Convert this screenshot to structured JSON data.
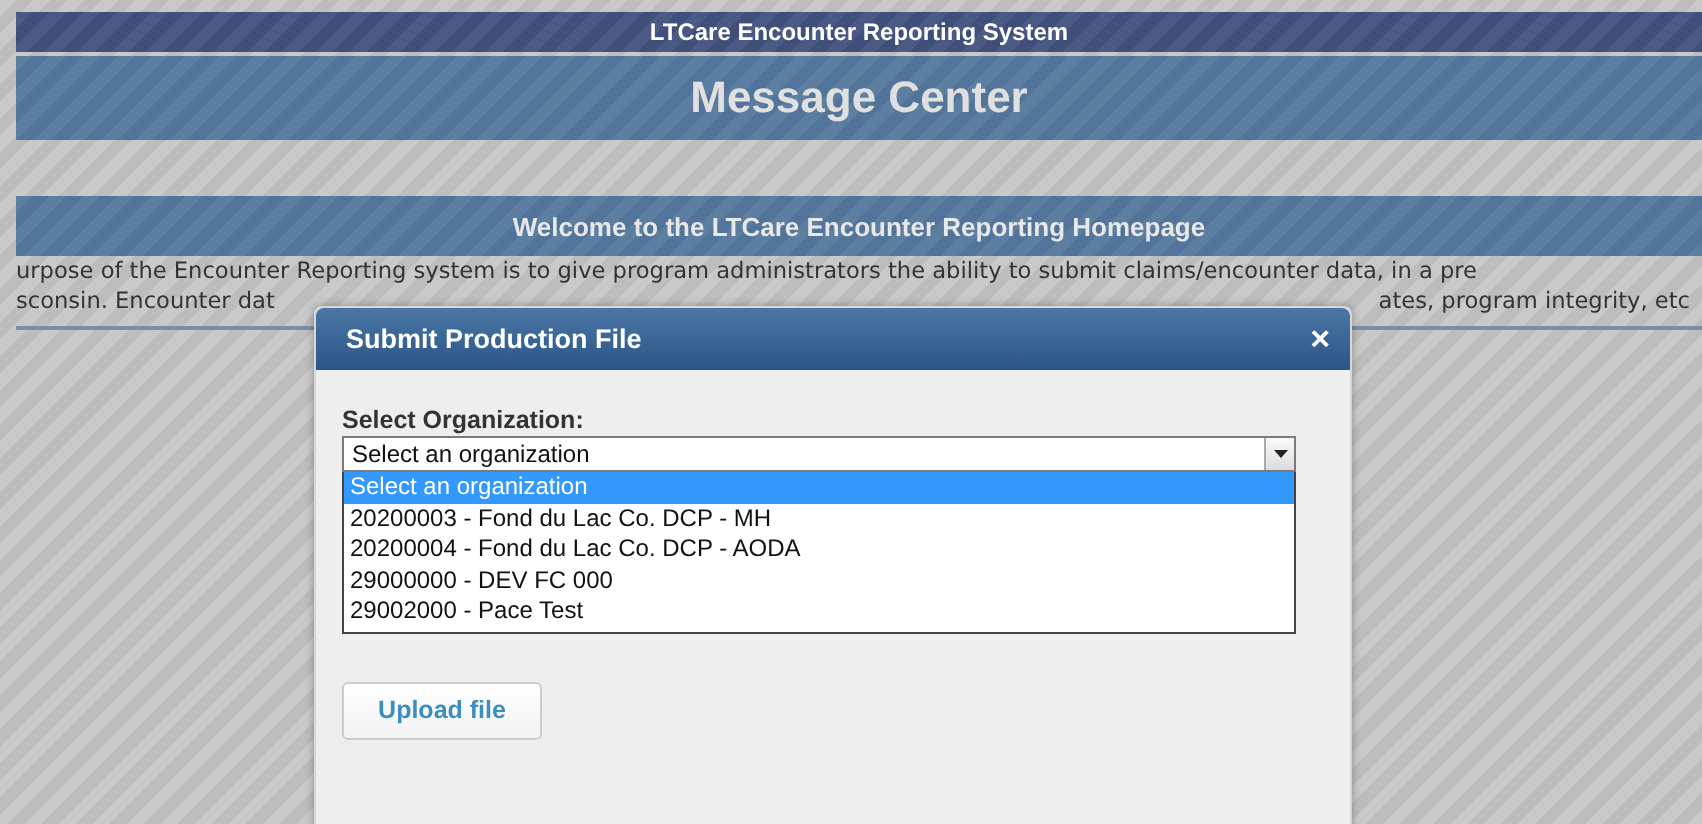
{
  "system_bar": {
    "title": "LTCare Encounter Reporting System"
  },
  "page_header": {
    "title": "Message Center"
  },
  "welcome_bar": {
    "title": "Welcome to the LTCare Encounter Reporting Homepage"
  },
  "intro_text": {
    "line_1": "urpose of the Encounter Reporting system is to give program administrators the ability to submit claims/encounter data, in a pre",
    "line_2_left": "sconsin. Encounter dat",
    "line_2_right": "ates, program integrity, etc"
  },
  "dialog": {
    "title": "Submit Production File",
    "close": "×",
    "field_label": "Select Organization:",
    "select_value": "Select an organization",
    "expanded": true,
    "options": [
      {
        "label": "Select an organization",
        "selected": true
      },
      {
        "label": "20200003 - Fond du Lac Co. DCP - MH",
        "selected": false
      },
      {
        "label": "20200004 - Fond du Lac Co. DCP - AODA",
        "selected": false
      },
      {
        "label": "29000000 - DEV FC 000",
        "selected": false
      },
      {
        "label": "29002000 - Pace Test",
        "selected": false
      }
    ],
    "button": "Upload file"
  }
}
